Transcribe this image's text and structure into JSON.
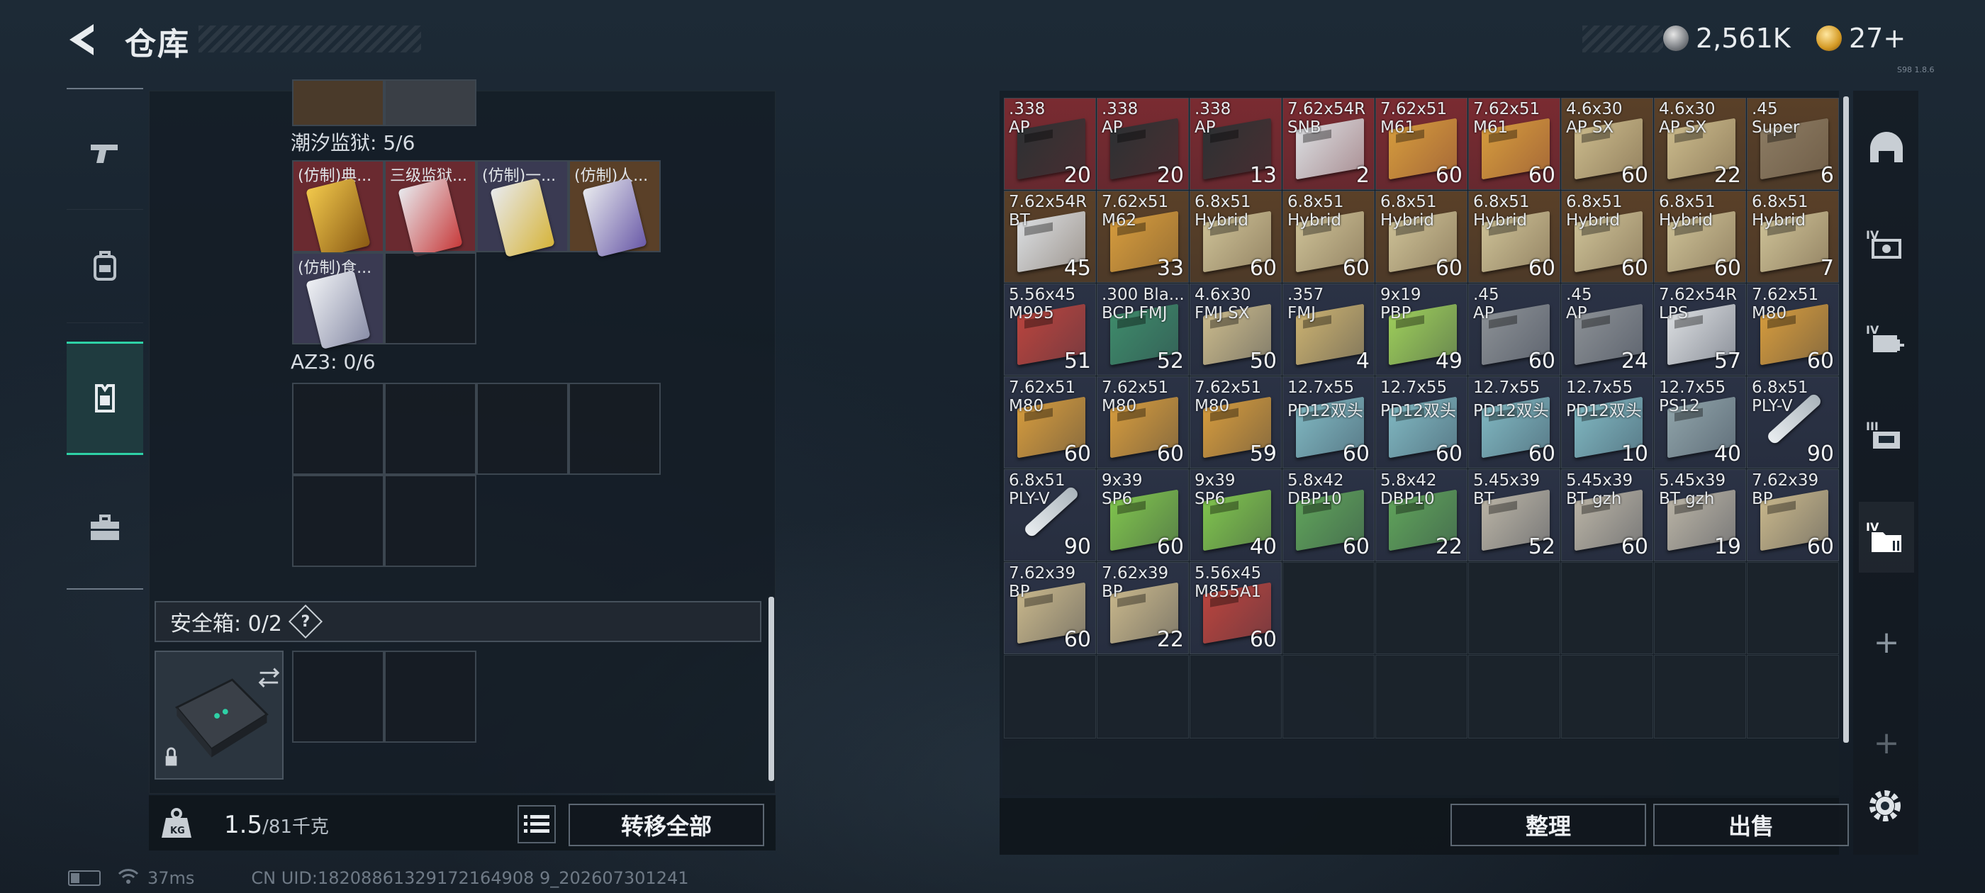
{
  "header": {
    "title": "仓库"
  },
  "currency": [
    {
      "value": "2,561K",
      "icon": "silver-coin-icon"
    },
    {
      "value": "27+",
      "icon": "gold-coin-icon"
    }
  ],
  "version_text": "S98 1.8.6",
  "left_nav": [
    "pistol-icon",
    "backpack-icon",
    "vest-icon",
    "toolbox-icon"
  ],
  "container1": {
    "label": "潮汐监狱: 5/6",
    "items": [
      "(仿制)典...",
      "三级监狱...",
      "(仿制)一...",
      "(仿制)人...",
      "(仿制)食..."
    ]
  },
  "container2": {
    "label": "AZ3: 0/6"
  },
  "safe": {
    "label": "安全箱: 0/2",
    "help": "?"
  },
  "weight": {
    "current": "1.5",
    "max": "/81千克",
    "icon": "kg-weight-icon"
  },
  "buttons": {
    "transfer_all": "转移全部",
    "sort": "整理",
    "sell": "出售"
  },
  "status": {
    "ping": "37ms",
    "uid": "CN UID:18208861329172164908 9_202607301241"
  },
  "right_nav": [
    "helmet-icon",
    "tier4-armor-icon",
    "tier4-medkit-icon",
    "tier3-rig-icon",
    "tier4-folder-icon",
    "plus-icon",
    "plus-icon"
  ],
  "inventory": [
    {
      "n1": ".338",
      "n2": "AP",
      "count": "20",
      "color": "#2d3133",
      "bg": "#7a2b31"
    },
    {
      "n1": ".338",
      "n2": "AP",
      "count": "20",
      "color": "#2d3133",
      "bg": "#7a2b31"
    },
    {
      "n1": ".338",
      "n2": "AP",
      "count": "13",
      "color": "#2d3133",
      "bg": "#7a2b31"
    },
    {
      "n1": "7.62x54R",
      "n2": "SNB",
      "count": "2",
      "color": "#d9dcdf",
      "bg": "#7a2b31"
    },
    {
      "n1": "7.62x51",
      "n2": "M61",
      "count": "60",
      "color": "#d39a3d",
      "bg": "#7a2b31"
    },
    {
      "n1": "7.62x51",
      "n2": "M61",
      "count": "60",
      "color": "#d39a3d",
      "bg": "#7a2b31"
    },
    {
      "n1": "4.6x30",
      "n2": "AP SX",
      "count": "60",
      "color": "#c9b98b",
      "bg": "#5a4028"
    },
    {
      "n1": "4.6x30",
      "n2": "AP SX",
      "count": "22",
      "color": "#c9b98b",
      "bg": "#5a4028"
    },
    {
      "n1": ".45",
      "n2": "Super",
      "count": "6",
      "color": "#8a7a62",
      "bg": "#5a4028"
    },
    {
      "n1": "7.62x54R",
      "n2": "BT",
      "count": "45",
      "color": "#d9dcdf",
      "bg": "#5a4028"
    },
    {
      "n1": "7.62x51",
      "n2": "M62",
      "count": "33",
      "color": "#d39a3d",
      "bg": "#5a4028"
    },
    {
      "n1": "6.8x51",
      "n2": "Hybrid",
      "count": "60",
      "color": "#cbbf95",
      "bg": "#5a4028"
    },
    {
      "n1": "6.8x51",
      "n2": "Hybrid",
      "count": "60",
      "color": "#cbbf95",
      "bg": "#5a4028"
    },
    {
      "n1": "6.8x51",
      "n2": "Hybrid",
      "count": "60",
      "color": "#cbbf95",
      "bg": "#5a4028"
    },
    {
      "n1": "6.8x51",
      "n2": "Hybrid",
      "count": "60",
      "color": "#cbbf95",
      "bg": "#5a4028"
    },
    {
      "n1": "6.8x51",
      "n2": "Hybrid",
      "count": "60",
      "color": "#cbbf95",
      "bg": "#5a4028"
    },
    {
      "n1": "6.8x51",
      "n2": "Hybrid",
      "count": "60",
      "color": "#cbbf95",
      "bg": "#5a4028"
    },
    {
      "n1": "6.8x51",
      "n2": "Hybrid",
      "count": "7",
      "color": "#cbbf95",
      "bg": "#5a4028"
    },
    {
      "n1": "5.56x45",
      "n2": "M995",
      "count": "51",
      "color": "#b8443e",
      "bg": "#2b3245"
    },
    {
      "n1": ".300 Bla...",
      "n2": "BCP FMJ",
      "count": "52",
      "color": "#3e8a6a",
      "bg": "#2b3245"
    },
    {
      "n1": "4.6x30",
      "n2": "FMJ SX",
      "count": "50",
      "color": "#c9b98b",
      "bg": "#2b3245"
    },
    {
      "n1": ".357",
      "n2": "FMJ",
      "count": "4",
      "color": "#c9b070",
      "bg": "#2b3245"
    },
    {
      "n1": "9x19",
      "n2": "PBP",
      "count": "49",
      "color": "#9ccc5a",
      "bg": "#2b3245"
    },
    {
      "n1": ".45",
      "n2": "AP",
      "count": "60",
      "color": "#8a8f94",
      "bg": "#2b3245"
    },
    {
      "n1": ".45",
      "n2": "AP",
      "count": "24",
      "color": "#8a8f94",
      "bg": "#2b3245"
    },
    {
      "n1": "7.62x54R",
      "n2": "LPS",
      "count": "57",
      "color": "#d9dcdf",
      "bg": "#2b3245"
    },
    {
      "n1": "7.62x51",
      "n2": "M80",
      "count": "60",
      "color": "#d39a3d",
      "bg": "#2b3245"
    },
    {
      "n1": "7.62x51",
      "n2": "M80",
      "count": "60",
      "color": "#d39a3d",
      "bg": "#2b3245"
    },
    {
      "n1": "7.62x51",
      "n2": "M80",
      "count": "60",
      "color": "#d39a3d",
      "bg": "#2b3245"
    },
    {
      "n1": "7.62x51",
      "n2": "M80",
      "count": "59",
      "color": "#d39a3d",
      "bg": "#2b3245"
    },
    {
      "n1": "12.7x55",
      "n2": "PD12双头",
      "count": "60",
      "color": "#7fb6c0",
      "bg": "#2b3245"
    },
    {
      "n1": "12.7x55",
      "n2": "PD12双头",
      "count": "60",
      "color": "#7fb6c0",
      "bg": "#2b3245"
    },
    {
      "n1": "12.7x55",
      "n2": "PD12双头",
      "count": "60",
      "color": "#7fb6c0",
      "bg": "#2b3245"
    },
    {
      "n1": "12.7x55",
      "n2": "PD12双头",
      "count": "10",
      "color": "#7fb6c0",
      "bg": "#2b3245"
    },
    {
      "n1": "12.7x55",
      "n2": "PS12",
      "count": "40",
      "color": "#8ea2a8",
      "bg": "#2b3245"
    },
    {
      "n1": "6.8x51",
      "n2": "PLY-V",
      "count": "90",
      "color": "syringe",
      "bg": "#2b3245"
    },
    {
      "n1": "6.8x51",
      "n2": "PLY-V",
      "count": "90",
      "color": "syringe",
      "bg": "#2b3245"
    },
    {
      "n1": "9x39",
      "n2": "SP6",
      "count": "60",
      "color": "#7fc24d",
      "bg": "#2b3245"
    },
    {
      "n1": "9x39",
      "n2": "SP6",
      "count": "40",
      "color": "#7fc24d",
      "bg": "#2b3245"
    },
    {
      "n1": "5.8x42",
      "n2": "DBP10",
      "count": "60",
      "color": "#5fa25a",
      "bg": "#2b3245"
    },
    {
      "n1": "5.8x42",
      "n2": "DBP10",
      "count": "22",
      "color": "#5fa25a",
      "bg": "#2b3245"
    },
    {
      "n1": "5.45x39",
      "n2": "BT",
      "count": "52",
      "color": "#b8b2a4",
      "bg": "#2b3245"
    },
    {
      "n1": "5.45x39",
      "n2": "BT gzh",
      "count": "60",
      "color": "#b8b2a4",
      "bg": "#2b3245"
    },
    {
      "n1": "5.45x39",
      "n2": "BT gzh",
      "count": "19",
      "color": "#b8b2a4",
      "bg": "#2b3245"
    },
    {
      "n1": "7.62x39",
      "n2": "BP",
      "count": "60",
      "color": "#c6b58a",
      "bg": "#2b3245"
    },
    {
      "n1": "7.62x39",
      "n2": "BP",
      "count": "60",
      "color": "#c6b58a",
      "bg": "#2b3245"
    },
    {
      "n1": "7.62x39",
      "n2": "BP",
      "count": "22",
      "color": "#c6b58a",
      "bg": "#2b3245"
    },
    {
      "n1": "5.56x45",
      "n2": "M855A1",
      "count": "60",
      "color": "#b8443e",
      "bg": "#2b3245"
    }
  ]
}
